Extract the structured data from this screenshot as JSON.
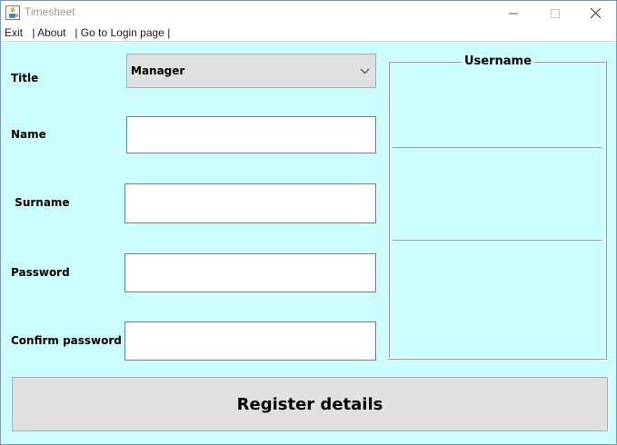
{
  "window": {
    "title": "Timesheet",
    "icon": "java-cup-icon"
  },
  "menu": {
    "exit": "Exit",
    "about": " | About",
    "login": " | Go to Login page |"
  },
  "form": {
    "title_label": "Title",
    "title_value": "Manager",
    "name_label": "Name",
    "name_value": "",
    "surname_label": " Surname",
    "surname_value": "",
    "password_label": "Password",
    "password_value": "",
    "confirm_label": "Confirm password",
    "confirm_value": ""
  },
  "username_panel": {
    "title": "Username"
  },
  "actions": {
    "register_label": "Register details"
  },
  "colors": {
    "content_bg": "#ccfefe",
    "button_bg": "#e1e1e1"
  }
}
